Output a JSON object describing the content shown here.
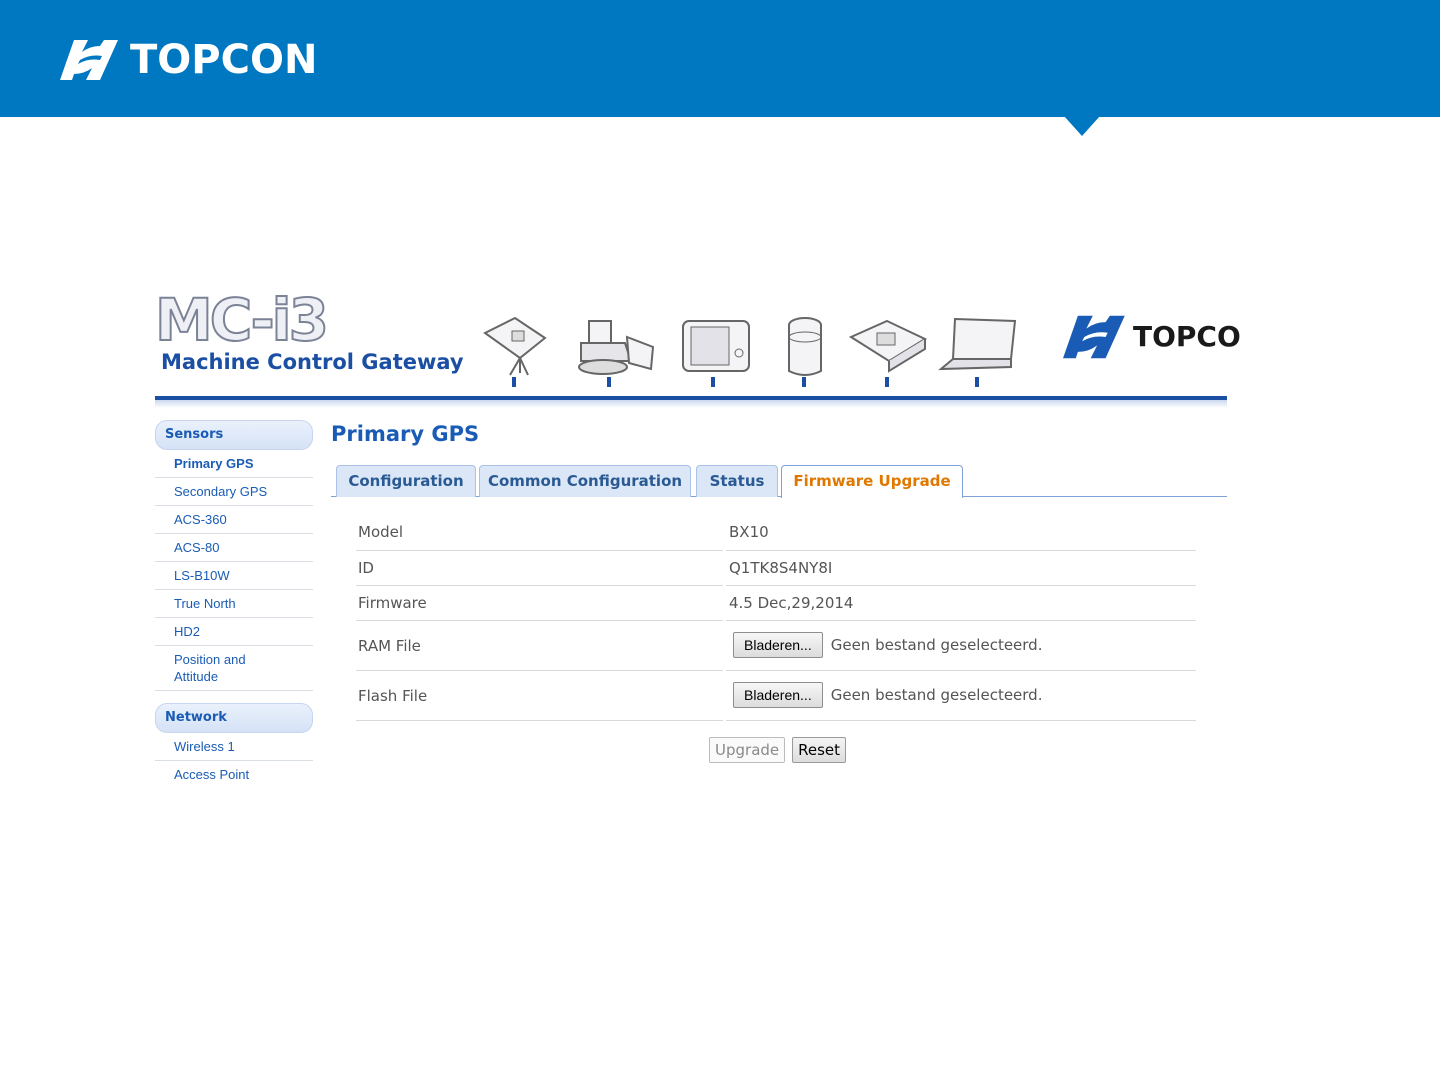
{
  "slide": {
    "brand": "TOPCON",
    "colors": {
      "banner": "#0077c1"
    }
  },
  "app": {
    "product_title": "MC-i3",
    "product_subtitle": "Machine Control Gateway",
    "header_brand": "TOPCO",
    "header_icons": [
      "survey-instrument-icon",
      "bulldozer-icon",
      "display-panel-icon",
      "gps-receiver-icon",
      "base-station-icon",
      "laptop-icon"
    ],
    "sidebar": {
      "sections": [
        {
          "title": "Sensors",
          "items": [
            "Primary GPS",
            "Secondary GPS",
            "ACS-360",
            "ACS-80",
            "LS-B10W",
            "True North",
            "HD2",
            "Position and Attitude"
          ]
        },
        {
          "title": "Network",
          "items": [
            "Wireless 1",
            "Access Point"
          ]
        }
      ],
      "active_item": "Primary GPS"
    },
    "page_title": "Primary GPS",
    "tabs": [
      "Configuration",
      "Common Configuration",
      "Status",
      "Firmware Upgrade"
    ],
    "active_tab": "Firmware Upgrade",
    "fields": {
      "model": {
        "label": "Model",
        "value": "BX10"
      },
      "id": {
        "label": "ID",
        "value": "Q1TK8S4NY8I"
      },
      "firmware": {
        "label": "Firmware",
        "value": "4.5 Dec,29,2014"
      },
      "ram_file": {
        "label": "RAM File",
        "button": "Bladeren...",
        "status": "Geen bestand geselecteerd."
      },
      "flash_file": {
        "label": "Flash File",
        "button": "Bladeren...",
        "status": "Geen bestand geselecteerd."
      }
    },
    "actions": {
      "upgrade": "Upgrade",
      "reset": "Reset"
    },
    "colors": {
      "accent": "#1a5cb5",
      "active_tab": "#e07800"
    }
  }
}
